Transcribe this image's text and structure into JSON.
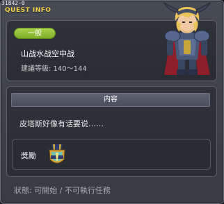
{
  "window": {
    "quest_id": "31842-0",
    "title": "QUEST INFO"
  },
  "quest": {
    "category": "一般",
    "name": "山战水战空中战",
    "level_text": "建議等級: 140～144"
  },
  "content": {
    "header": "内容",
    "text": "皮塔斯好像有话要说……"
  },
  "reward": {
    "label": "獎勵",
    "icon": "medal-icon"
  },
  "status": {
    "text": "狀態: 可開始 / 不可執行任務"
  },
  "colors": {
    "title": "#f4d24a",
    "badge": "#8fbe33",
    "panel": "#2f3239"
  }
}
